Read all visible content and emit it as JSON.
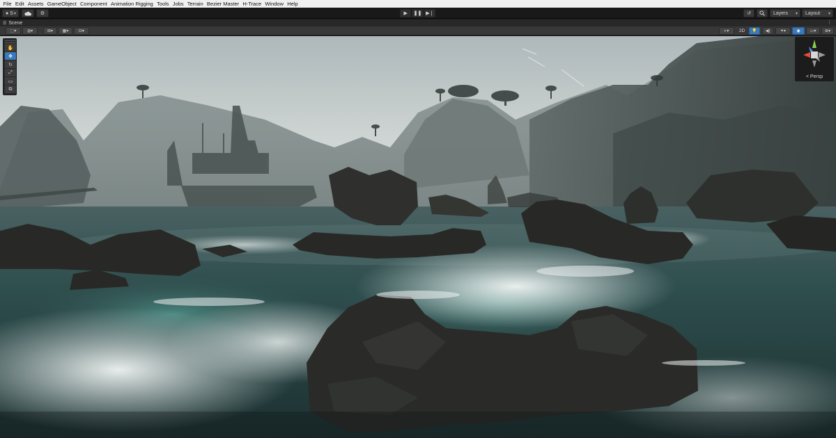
{
  "menubar": {
    "items": [
      "File",
      "Edit",
      "Assets",
      "GameObject",
      "Component",
      "Animation Rigging",
      "Tools",
      "Jobs",
      "Terrain",
      "Bezier Master",
      "H-Trace",
      "Window",
      "Help"
    ]
  },
  "toolbar": {
    "account_label": "S",
    "account_icon": "account-icon",
    "cloud_icon": "cloud-icon",
    "collab_icon": "settings-icon",
    "play_icon": "play-icon",
    "pause_icon": "pause-icon",
    "step_icon": "step-icon",
    "history_icon": "undo-history-icon",
    "search_icon": "search-icon",
    "layers_label": "Layers",
    "layout_label": "Layout"
  },
  "scene_tab": {
    "label": "Scene",
    "icon": "scene-icon",
    "menu_icon": "more-vertical-icon"
  },
  "scene_toolbar": {
    "toggle_2d_label": "2D",
    "lighting_active": true,
    "accent_color": "#3a79bb"
  },
  "tools": [
    "view-tool",
    "move-tool",
    "rotate-tool",
    "scale-tool",
    "rect-tool",
    "transform-tool"
  ],
  "active_tool": "move-tool",
  "gizmo": {
    "projection_label": "< Persp",
    "y_color": "#8bd14b",
    "x_color": "#e24b3c",
    "z_color": "#4b8de2"
  },
  "scene_colors": {
    "sky_top": "#b8c2c4",
    "sky_horizon": "#d3d8d6",
    "sea": "#2b4a4c",
    "foam": "#e6efee",
    "rock": "#2b2c2a"
  }
}
